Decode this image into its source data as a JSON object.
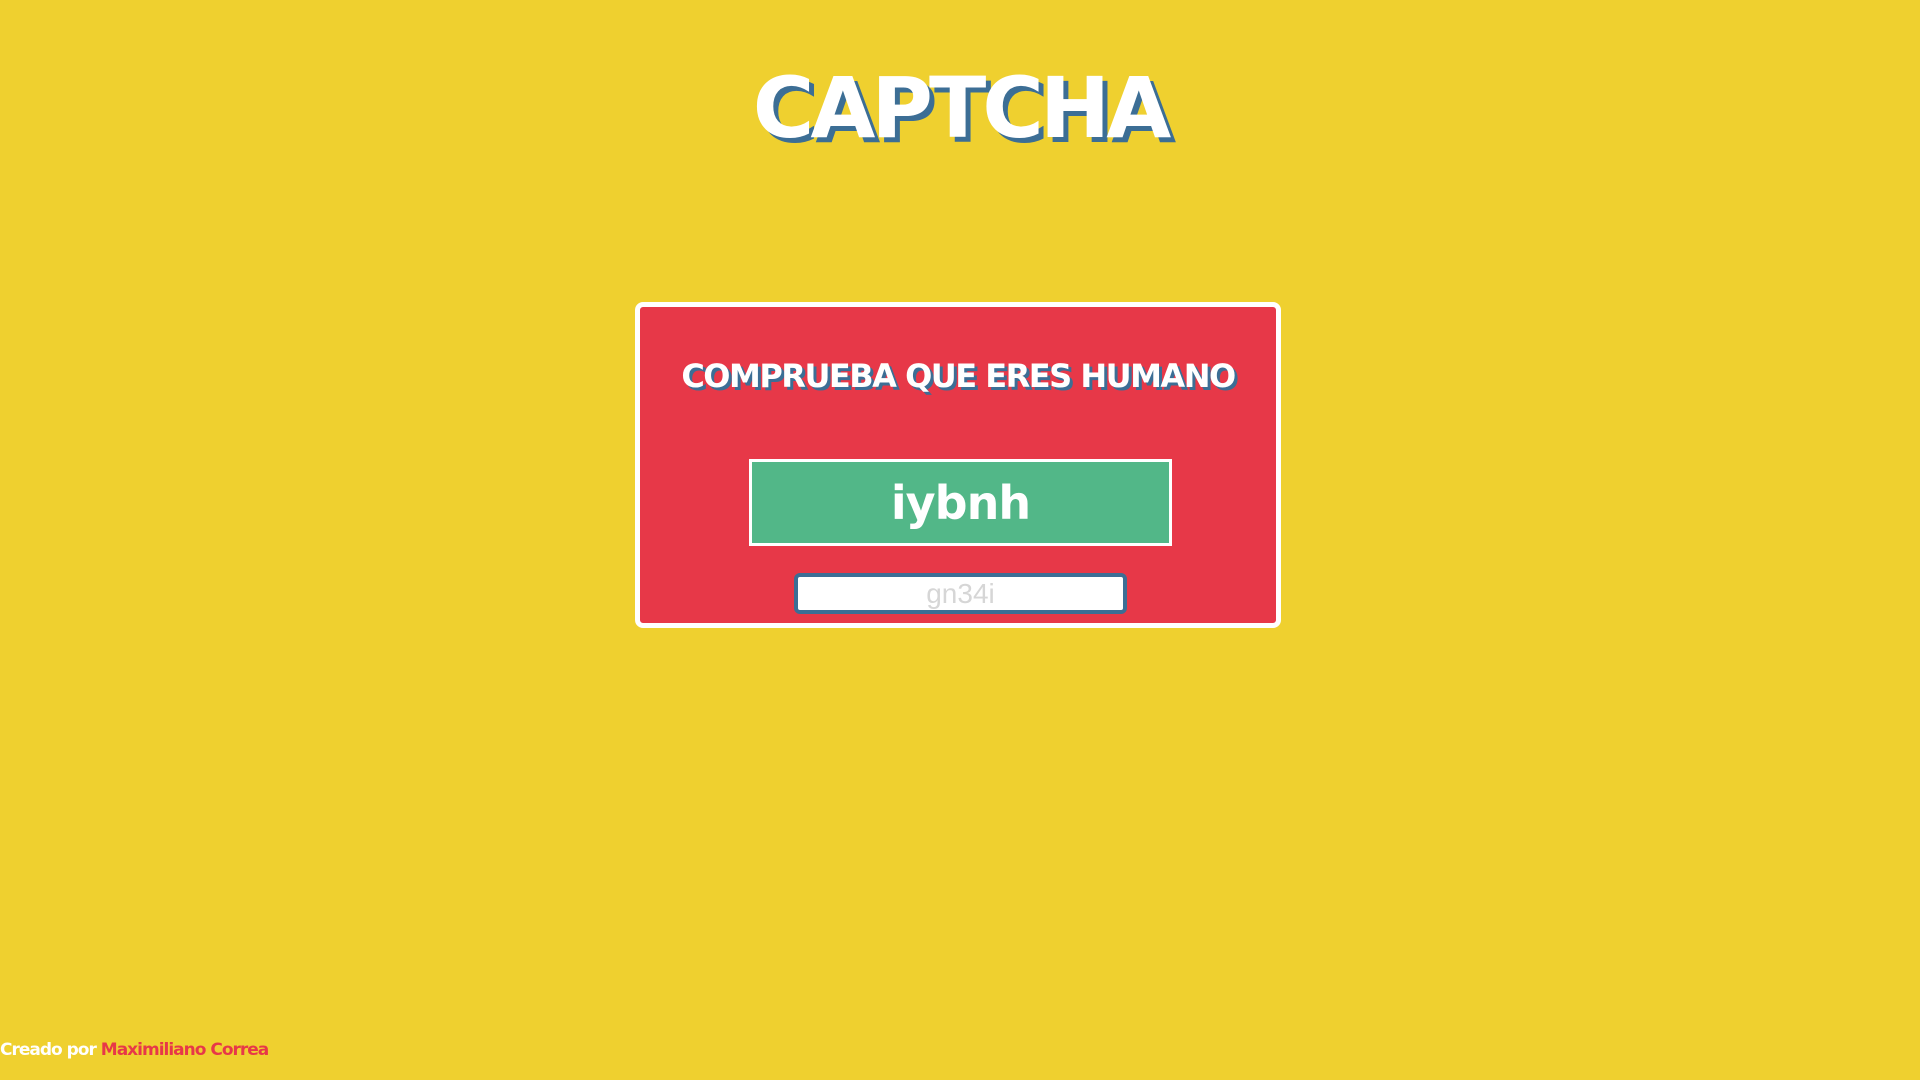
{
  "page": {
    "title": "CAPTCHA"
  },
  "captcha": {
    "heading": "COMPRUEBA QUE ERES HUMANO",
    "code": "iybnh",
    "input": {
      "value": "",
      "placeholder": "gn34i"
    }
  },
  "footer": {
    "prefix": "Creado por",
    "author": "Maximiliano Correa"
  },
  "colors": {
    "background": "#efd02f",
    "card": "#e73848",
    "code_box": "#52b788",
    "accent_shadow": "#3c6e95",
    "text": "#ffffff"
  }
}
